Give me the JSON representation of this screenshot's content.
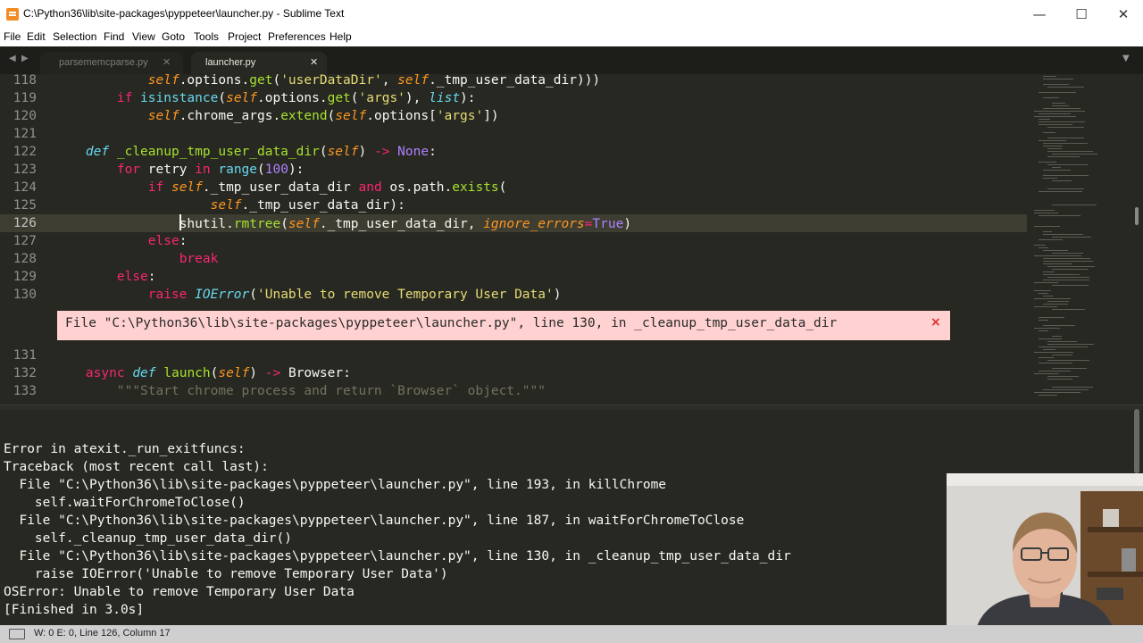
{
  "window": {
    "title": "C:\\Python36\\lib\\site-packages\\pyppeteer\\launcher.py - Sublime Text",
    "minimize": "—",
    "maximize": "☐",
    "close": "✕"
  },
  "menu": [
    "File",
    "Edit",
    "Selection",
    "Find",
    "View",
    "Goto",
    "Tools",
    "Project",
    "Preferences",
    "Help"
  ],
  "tabs": [
    {
      "label": "parsememcparse.py",
      "close": "✕",
      "active": false
    },
    {
      "label": "launcher.py",
      "close": "✕",
      "active": true
    }
  ],
  "nav": {
    "back": "◀",
    "forward": "▶",
    "overflow": "▼"
  },
  "code": {
    "partial_top_text": "            self.options.get('userDataDir', self._tmp_user_data_dir)))",
    "line_numbers": [
      "118",
      "119",
      "120",
      "121",
      "122",
      "123",
      "124",
      "125",
      "126",
      "127",
      "128",
      "129",
      "130",
      "131",
      "132",
      "133"
    ],
    "current_line": "126",
    "lines": [
      "            self.options.get('userDataDir', self._tmp_user_data_dir)))",
      "        if isinstance(self.options.get('args'), list):",
      "            self.chrome_args.extend(self.options['args'])",
      "",
      "    def _cleanup_tmp_user_data_dir(self) -> None:",
      "        for retry in range(100):",
      "            if self._tmp_user_data_dir and os.path.exists(",
      "                    self._tmp_user_data_dir):",
      "                shutil.rmtree(self._tmp_user_data_dir, ignore_errors=True)",
      "            else:",
      "                break",
      "        else:",
      "            raise IOError('Unable to remove Temporary User Data')",
      "",
      "    async def launch(self) -> Browser:",
      "        \"\"\"Start chrome process and return `Browser` object.\"\"\""
    ]
  },
  "error_phantom": {
    "text": "File \"C:\\Python36\\lib\\site-packages\\pyppeteer\\launcher.py\", line 130, in _cleanup_tmp_user_data_dir",
    "close": "×"
  },
  "output": [
    "Error in atexit._run_exitfuncs:",
    "Traceback (most recent call last):",
    "  File \"C:\\Python36\\lib\\site-packages\\pyppeteer\\launcher.py\", line 193, in killChrome",
    "    self.waitForChromeToClose()",
    "  File \"C:\\Python36\\lib\\site-packages\\pyppeteer\\launcher.py\", line 187, in waitForChromeToClose",
    "    self._cleanup_tmp_user_data_dir()",
    "  File \"C:\\Python36\\lib\\site-packages\\pyppeteer\\launcher.py\", line 130, in _cleanup_tmp_user_data_dir",
    "    raise IOError('Unable to remove Temporary User Data')",
    "OSError: Unable to remove Temporary User Data",
    "[Finished in 3.0s]"
  ],
  "status": {
    "text": "W: 0 E: 0, Line 126, Column 17"
  },
  "colors": {
    "editor_bg": "#272822",
    "keyword": "#f92672",
    "function": "#a6e22e",
    "string": "#e6db74",
    "number": "#ae81ff",
    "self": "#fd971f",
    "error_bg": "#ffd1d1"
  }
}
